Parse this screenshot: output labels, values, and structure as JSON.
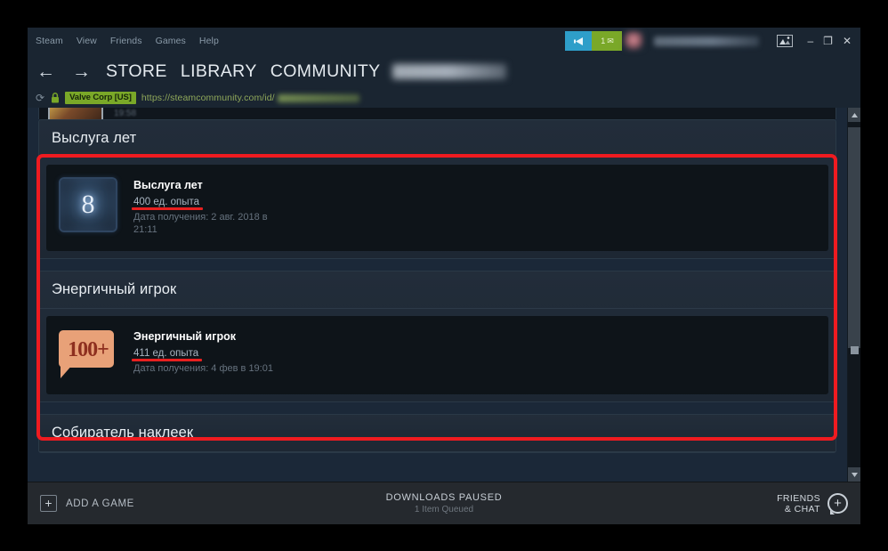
{
  "window": {
    "menu": [
      "Steam",
      "View",
      "Friends",
      "Games",
      "Help"
    ],
    "notification_count": "1",
    "username_hidden": "",
    "controls": {
      "minimize": "–",
      "maximize": "❐",
      "close": "✕"
    },
    "icons": {
      "broadcast": "broadcast-icon",
      "mail": "✉",
      "screenshot": "screenshot-icon"
    }
  },
  "nav": {
    "back": "←",
    "forward": "→",
    "links": [
      "STORE",
      "LIBRARY",
      "COMMUNITY"
    ],
    "profile_hidden": ""
  },
  "urlbar": {
    "reload": "⟳",
    "lock": "lock-icon",
    "certificate": "Valve Corp [US]",
    "url": "https://steamcommunity.com/id/"
  },
  "page": {
    "clipped_top_text": "19:58",
    "sections": [
      {
        "title": "Выслуга лет",
        "badge": {
          "icon_type": "level-plaque",
          "icon_label": "8",
          "name": "Выслуга лет",
          "xp": "400 ед. опыта",
          "date": "Дата получения: 2 авг. 2018 в 21:11"
        }
      },
      {
        "title": "Энергичный игрок",
        "badge": {
          "icon_type": "speech-bubble",
          "icon_label": "100+",
          "name": "Энергичный игрок",
          "xp": "411 ед. опыта",
          "date": "Дата получения: 4 фев в 19:01"
        }
      }
    ],
    "next_section_title": "Собиратель наклеек"
  },
  "annotation": {
    "color": "#ef1b20",
    "shape": "rectangle"
  },
  "scrollbar": {
    "up_arrow": "▲",
    "down_arrow": "▼"
  },
  "bottombar": {
    "add_game": "ADD A GAME",
    "add_icon": "+",
    "downloads_title": "DOWNLOADS PAUSED",
    "downloads_sub": "1 Item Queued",
    "friends_line1": "FRIENDS",
    "friends_line2": "& CHAT",
    "friends_icon": "+"
  }
}
